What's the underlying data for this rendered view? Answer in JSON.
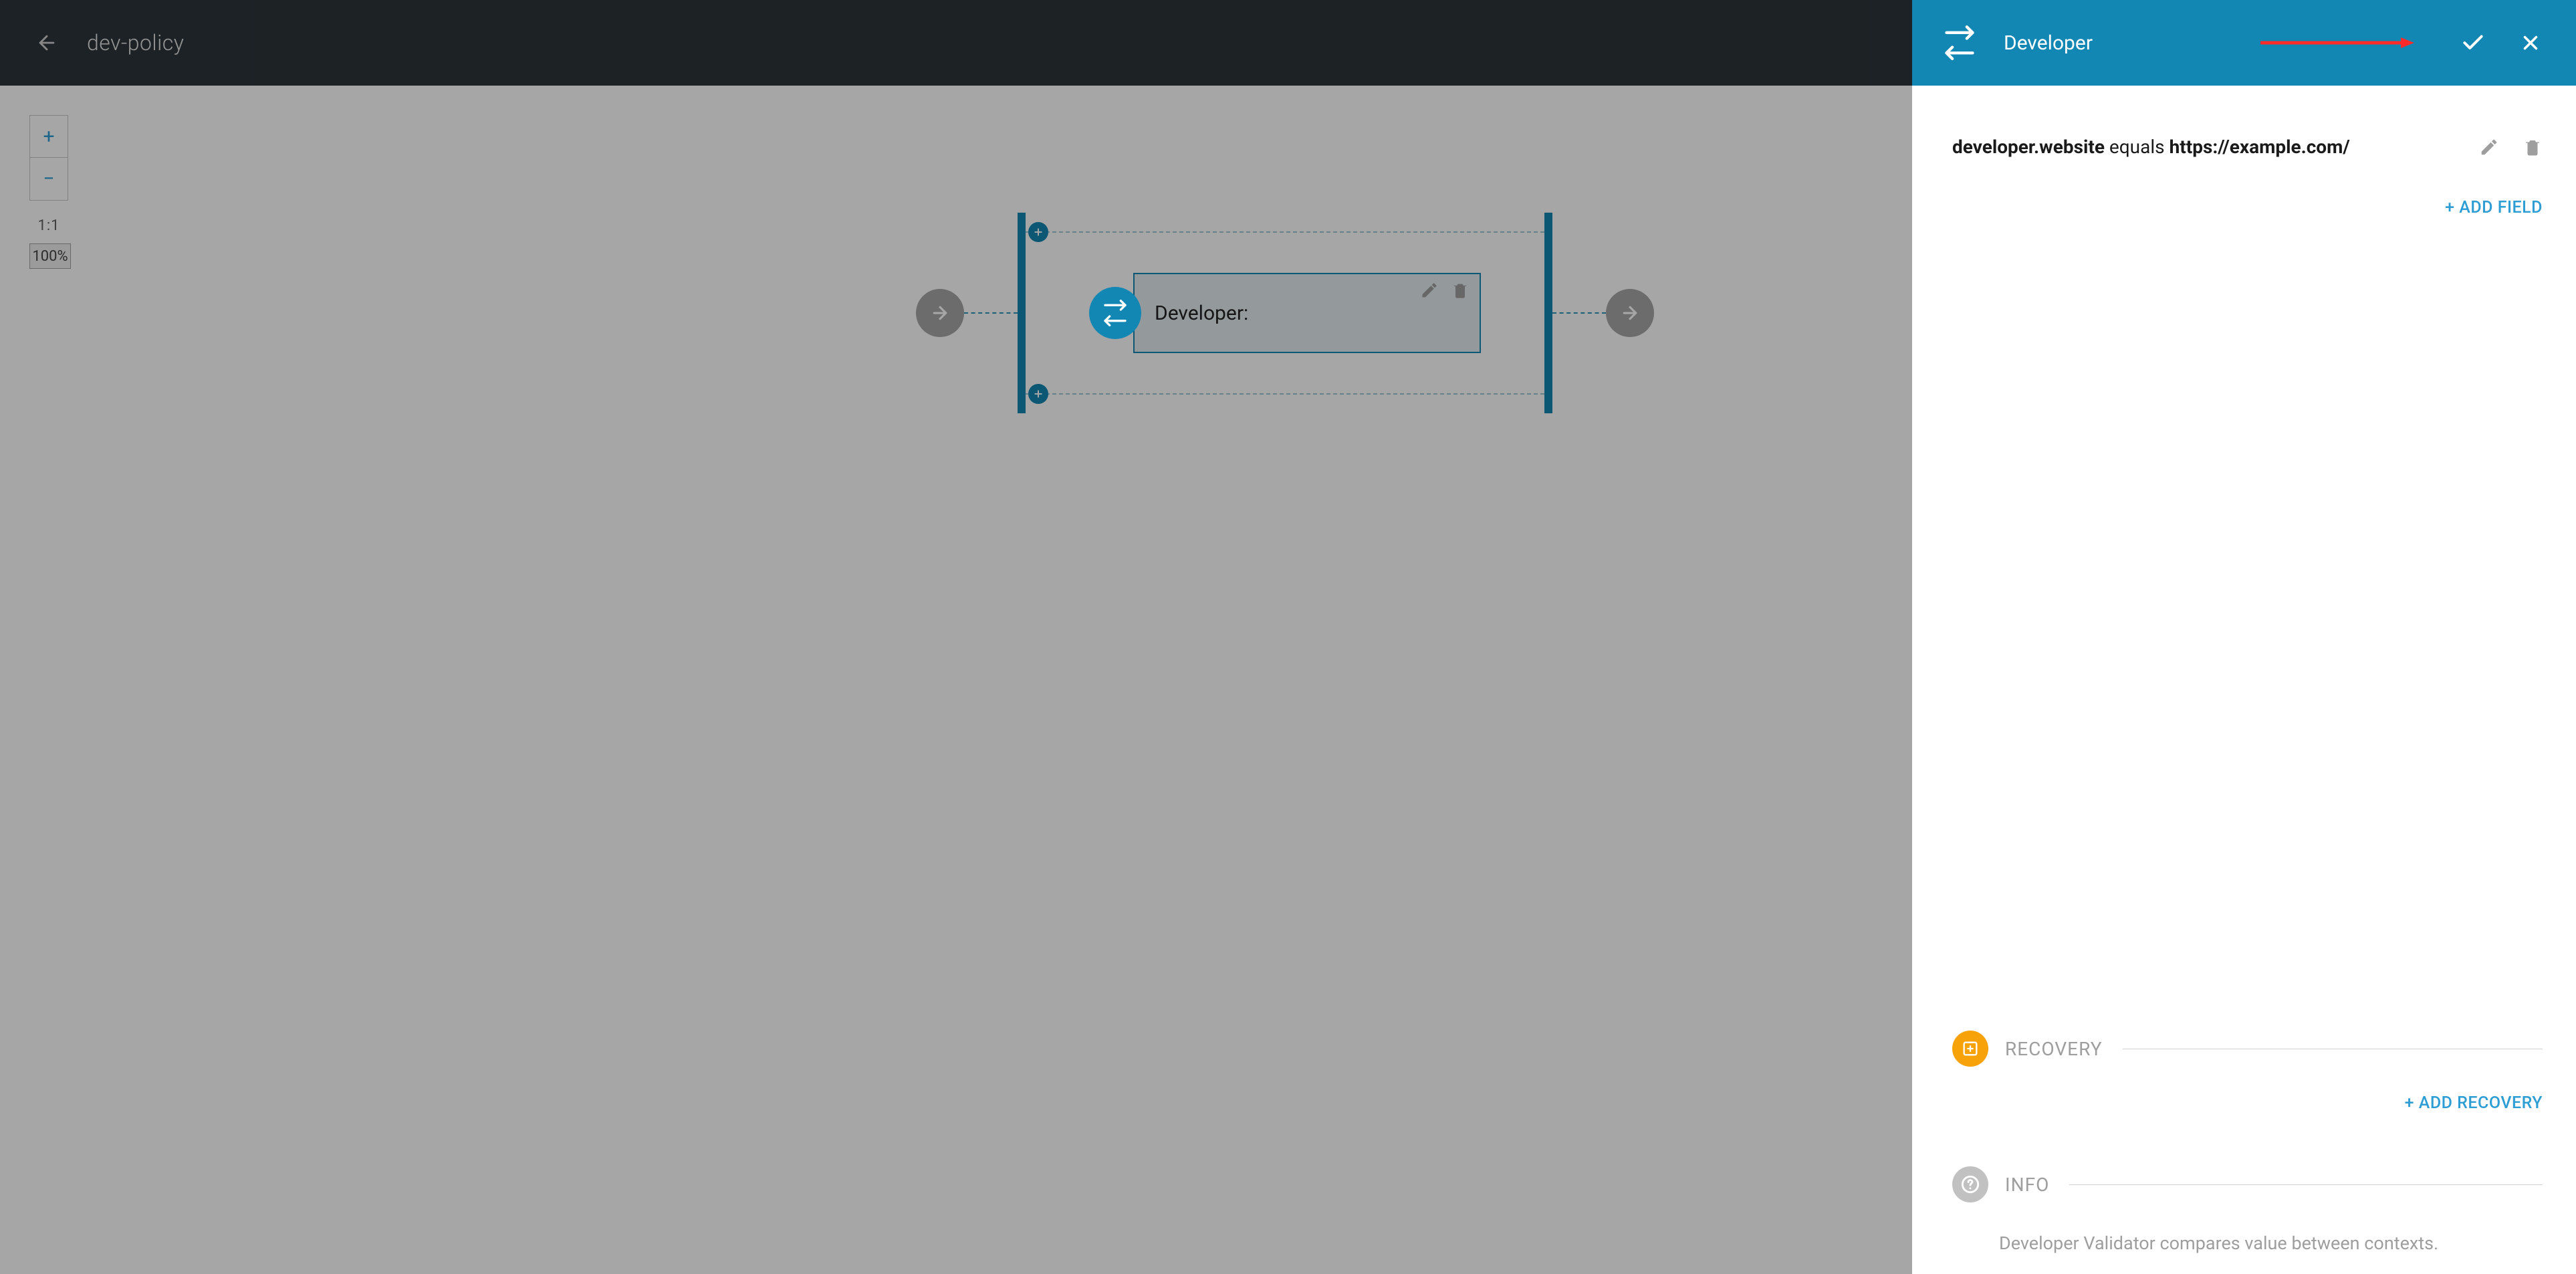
{
  "topbar": {
    "title": "dev-policy"
  },
  "zoom": {
    "plus": "+",
    "minus": "−",
    "scale": "1:1",
    "pct": "100%"
  },
  "flow": {
    "node_label": "Developer:"
  },
  "panel": {
    "title": "Developer",
    "field_attr": "developer.website",
    "field_op": "equals",
    "field_val": "https://example.com/",
    "add_field": "+ ADD FIELD",
    "recovery_label": "RECOVERY",
    "add_recovery": "+ ADD RECOVERY",
    "info_label": "INFO",
    "info_text": "Developer Validator compares value between contexts."
  }
}
